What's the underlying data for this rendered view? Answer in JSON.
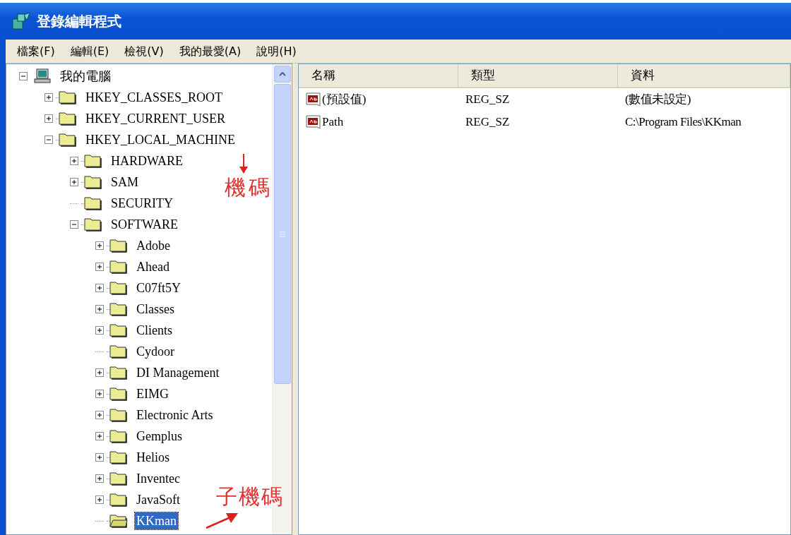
{
  "window": {
    "title": "登錄編輯程式"
  },
  "menu": [
    "檔案(F)",
    "編輯(E)",
    "檢視(V)",
    "我的最愛(A)",
    "說明(H)"
  ],
  "tree": {
    "label": "我的電腦",
    "kind": "branch",
    "expanded": true,
    "selected": false,
    "children": [
      {
        "label": "HKEY_CLASSES_ROOT",
        "kind": "branch",
        "expanded": false,
        "selected": false
      },
      {
        "label": "HKEY_CURRENT_USER",
        "kind": "branch",
        "expanded": false,
        "selected": false
      },
      {
        "label": "HKEY_LOCAL_MACHINE",
        "kind": "branch",
        "expanded": true,
        "selected": false,
        "children": [
          {
            "label": "HARDWARE",
            "kind": "branch",
            "expanded": false,
            "selected": false
          },
          {
            "label": "SAM",
            "kind": "branch",
            "expanded": false,
            "selected": false
          },
          {
            "label": "SECURITY",
            "kind": "leaf",
            "selected": false
          },
          {
            "label": "SOFTWARE",
            "kind": "branch",
            "expanded": true,
            "selected": false,
            "children": [
              {
                "label": "Adobe",
                "kind": "branch",
                "expanded": false,
                "selected": false
              },
              {
                "label": "Ahead",
                "kind": "branch",
                "expanded": false,
                "selected": false
              },
              {
                "label": "C07ft5Y",
                "kind": "branch",
                "expanded": false,
                "selected": false
              },
              {
                "label": "Classes",
                "kind": "branch",
                "expanded": false,
                "selected": false
              },
              {
                "label": "Clients",
                "kind": "branch",
                "expanded": false,
                "selected": false
              },
              {
                "label": "Cydoor",
                "kind": "leaf",
                "selected": false
              },
              {
                "label": "DI Management",
                "kind": "branch",
                "expanded": false,
                "selected": false
              },
              {
                "label": "EIMG",
                "kind": "branch",
                "expanded": false,
                "selected": false
              },
              {
                "label": "Electronic Arts",
                "kind": "branch",
                "expanded": false,
                "selected": false
              },
              {
                "label": "Gemplus",
                "kind": "branch",
                "expanded": false,
                "selected": false
              },
              {
                "label": "Helios",
                "kind": "branch",
                "expanded": false,
                "selected": false
              },
              {
                "label": "Inventec",
                "kind": "branch",
                "expanded": false,
                "selected": false
              },
              {
                "label": "JavaSoft",
                "kind": "branch",
                "expanded": false,
                "selected": false
              },
              {
                "label": "KKman",
                "kind": "leaf",
                "selected": true
              }
            ]
          }
        ]
      }
    ]
  },
  "values": {
    "columns": [
      "名稱",
      "類型",
      "資料"
    ],
    "rows": [
      {
        "name": "(預設值)",
        "type": "REG_SZ",
        "data": "(數值未設定)"
      },
      {
        "name": "Path",
        "type": "REG_SZ",
        "data": "C:\\Program Files\\KKman"
      }
    ]
  },
  "annotations": [
    {
      "text": "機碼",
      "kind": "downarrow"
    },
    {
      "text": "子機碼",
      "kind": "diagonalarrow"
    }
  ]
}
